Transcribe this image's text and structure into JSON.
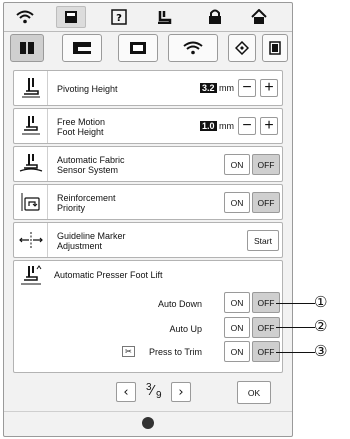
{
  "topbar": {
    "icons": [
      "wifi-icon",
      "page-icon",
      "help-icon",
      "foot-icon",
      "lock-icon",
      "home-icon"
    ]
  },
  "tabs": [
    "machine-settings-tab",
    "sewing-settings-tab",
    "display-settings-tab",
    "wireless-tab",
    "format-tab",
    "screen-tab"
  ],
  "rows": {
    "pivoting": {
      "label": "Pivoting Height",
      "value": "3.2",
      "unit": "mm"
    },
    "free_motion": {
      "label": "Free Motion\nFoot Height",
      "value": "1.0",
      "unit": "mm"
    },
    "fabric_sensor": {
      "label": "Automatic Fabric\nSensor System",
      "on": "ON",
      "off": "OFF"
    },
    "reinforcement": {
      "label": "Reinforcement\nPriority",
      "on": "ON",
      "off": "OFF"
    },
    "guideline": {
      "label": "Guideline Marker\nAdjustment",
      "button": "Start"
    },
    "presser": {
      "label": "Automatic Presser Foot Lift",
      "auto_down": {
        "label": "Auto Down",
        "on": "ON",
        "off": "OFF"
      },
      "auto_up": {
        "label": "Auto Up",
        "on": "ON",
        "off": "OFF"
      },
      "press_trim": {
        "label": "Press to Trim",
        "on": "ON",
        "off": "OFF"
      }
    }
  },
  "pager": {
    "current": "3",
    "total": "9"
  },
  "ok_label": "OK",
  "callouts": [
    "①",
    "②",
    "③"
  ]
}
